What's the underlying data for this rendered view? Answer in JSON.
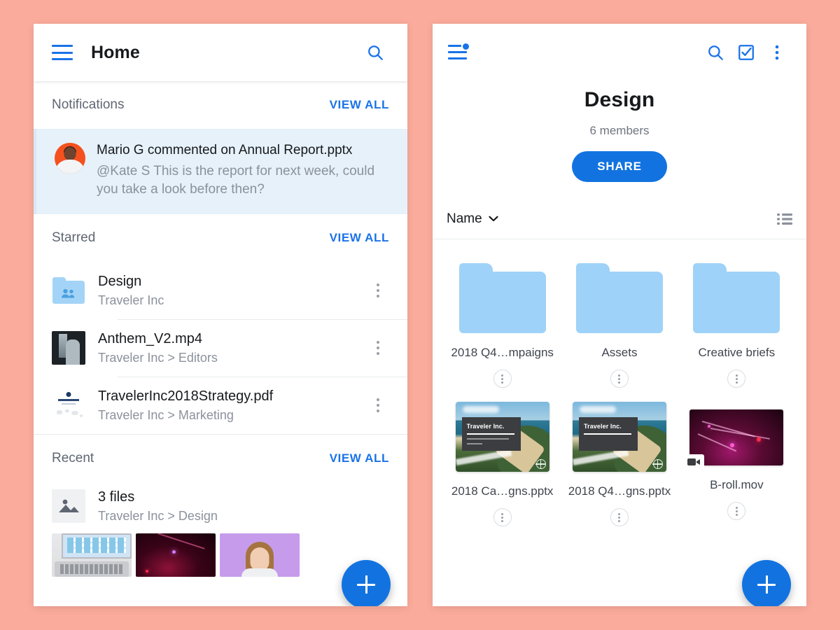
{
  "theme": {
    "background": "#faab9b",
    "accent": "#1a73e8",
    "fab": "#1273e0",
    "folder_blue": "#9fd2f8",
    "notif_card_bg": "#e6f1fa",
    "avatar_bg": "#f4511e",
    "muted_text": "#8b919c"
  },
  "home": {
    "appbar": {
      "menu_icon": "hamburger-menu-icon",
      "title": "Home",
      "search_icon": "search-icon"
    },
    "sections": [
      {
        "title": "Notifications",
        "action": "VIEW ALL"
      },
      {
        "title": "Starred",
        "action": "VIEW ALL"
      },
      {
        "title": "Recent",
        "action": "VIEW ALL"
      }
    ],
    "notification": {
      "avatar_name": "mario-g-avatar",
      "title": "Mario G commented on Annual Report.pptx",
      "body": "@Kate S This is the report for next week, could you take a look before then?"
    },
    "starred_items": [
      {
        "name": "Design",
        "path": "Traveler Inc",
        "thumb": "shared-folder-icon",
        "menu_icon": "kebab-menu-icon"
      },
      {
        "name": "Anthem_V2.mp4",
        "path": "Traveler Inc > Editors",
        "thumb": "video-thumbnail",
        "menu_icon": "kebab-menu-icon"
      },
      {
        "name": "TravelerInc2018Strategy.pdf",
        "path": "Traveler Inc > Marketing",
        "thumb": "pdf-thumbnail",
        "menu_icon": "kebab-menu-icon"
      }
    ],
    "recent_item": {
      "name": "3 files",
      "path": "Traveler Inc > Design",
      "thumb": "image-stack-icon"
    },
    "recent_thumbnails": [
      {
        "name": "laptop-spreadsheet-thumbnail"
      },
      {
        "name": "concert-stage-thumbnail"
      },
      {
        "name": "portrait-purple-thumbnail"
      }
    ],
    "fab": {
      "label": "+",
      "icon": "plus-icon"
    }
  },
  "folder": {
    "appbar": {
      "menu_icon": "hamburger-menu-with-badge-icon",
      "search_icon": "search-icon",
      "select_icon": "checkbox-checked-icon",
      "overflow_icon": "kebab-menu-icon"
    },
    "title": "Design",
    "members": "6 members",
    "share_label": "SHARE",
    "sort": {
      "label": "Name",
      "chevron_icon": "chevron-down-icon",
      "view_toggle_icon": "list-view-icon"
    },
    "items": [
      {
        "label": "2018 Q4…mpaigns",
        "type": "folder",
        "menu_icon": "kebab-menu-icon"
      },
      {
        "label": "Assets",
        "type": "folder",
        "menu_icon": "kebab-menu-icon"
      },
      {
        "label": "Creative briefs",
        "type": "folder",
        "menu_icon": "kebab-menu-icon"
      },
      {
        "label": "2018 Ca…gns.pptx",
        "type": "slide",
        "slide_title": "Traveler Inc.",
        "menu_icon": "kebab-menu-icon"
      },
      {
        "label": "2018 Q4…gns.pptx",
        "type": "slide",
        "slide_title": "Traveler Inc.",
        "menu_icon": "kebab-menu-icon"
      },
      {
        "label": "B-roll.mov",
        "type": "video",
        "menu_icon": "kebab-menu-icon"
      }
    ],
    "fab": {
      "label": "+",
      "icon": "plus-icon"
    }
  }
}
